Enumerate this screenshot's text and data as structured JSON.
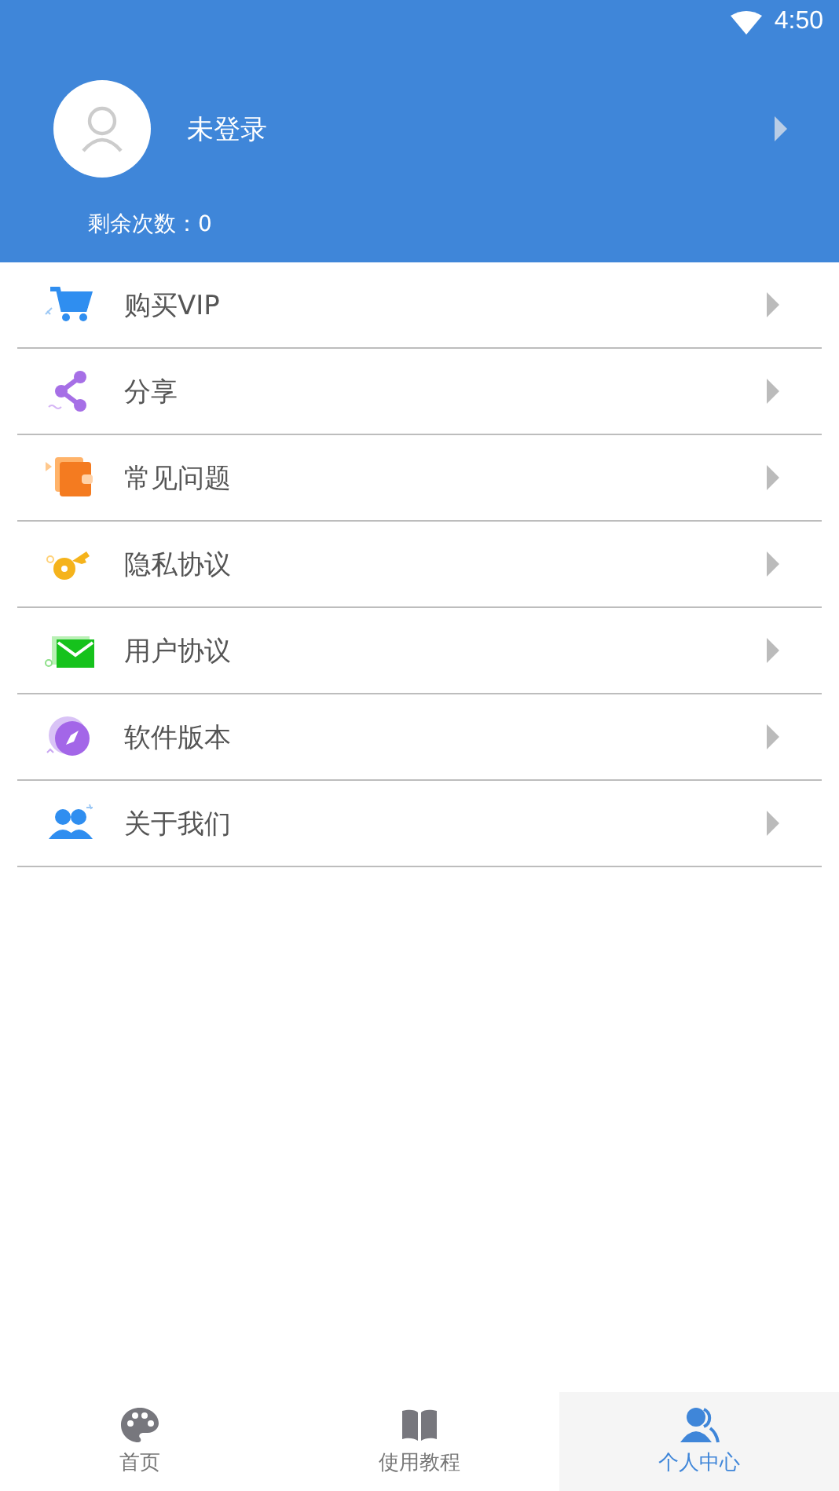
{
  "status_bar": {
    "time": "4:50"
  },
  "profile": {
    "name": "未登录",
    "remaining": "剩余次数：0"
  },
  "menu": [
    {
      "label": "购买VIP",
      "kind": "cart"
    },
    {
      "label": "分享",
      "kind": "share"
    },
    {
      "label": "常见问题",
      "kind": "wallet"
    },
    {
      "label": "隐私协议",
      "kind": "key"
    },
    {
      "label": "用户协议",
      "kind": "mail"
    },
    {
      "label": "软件版本",
      "kind": "compass"
    },
    {
      "label": "关于我们",
      "kind": "people"
    }
  ],
  "tabs": [
    {
      "label": "首页",
      "kind": "palette",
      "selected": false
    },
    {
      "label": "使用教程",
      "kind": "book",
      "selected": false
    },
    {
      "label": "个人中心",
      "kind": "person",
      "selected": true
    }
  ]
}
